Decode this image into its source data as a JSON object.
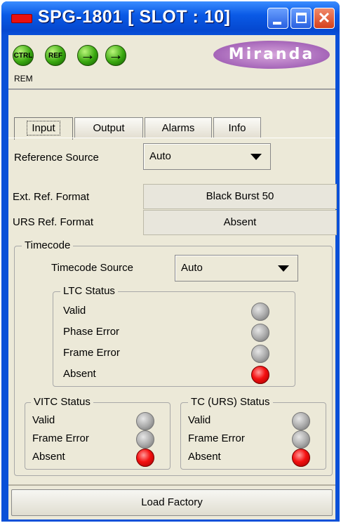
{
  "window": {
    "title": "SPG-1801 [ SLOT : 10]",
    "controls": {
      "minimize_icon": "minimize-icon",
      "maximize_icon": "maximize-icon",
      "close_icon": "close-icon",
      "close_glyph": "✕"
    }
  },
  "header": {
    "leds": [
      {
        "label": "CTRL",
        "color": "green"
      },
      {
        "label": "REF",
        "color": "green"
      },
      {
        "label": "→",
        "color": "green"
      },
      {
        "label": "→",
        "color": "green"
      }
    ],
    "mode_label": "REM",
    "brand": "Miranda"
  },
  "tabs": [
    {
      "label": "Input",
      "active": true
    },
    {
      "label": "Output",
      "active": false
    },
    {
      "label": "Alarms",
      "active": false
    },
    {
      "label": "Info",
      "active": false
    }
  ],
  "input": {
    "reference_source_label": "Reference Source",
    "reference_source_value": "Auto",
    "ext_ref_format_label": "Ext. Ref. Format",
    "ext_ref_format_value": "Black Burst 50",
    "urs_ref_format_label": "URS Ref. Format",
    "urs_ref_format_value": "Absent"
  },
  "timecode": {
    "title": "Timecode",
    "source_label": "Timecode Source",
    "source_value": "Auto",
    "ltc": {
      "title": "LTC Status",
      "rows": [
        {
          "label": "Valid",
          "state": "gray"
        },
        {
          "label": "Phase Error",
          "state": "gray"
        },
        {
          "label": "Frame Error",
          "state": "gray"
        },
        {
          "label": "Absent",
          "state": "red"
        }
      ]
    },
    "vitc": {
      "title": "VITC Status",
      "rows": [
        {
          "label": "Valid",
          "state": "gray"
        },
        {
          "label": "Frame Error",
          "state": "gray"
        },
        {
          "label": "Absent",
          "state": "red"
        }
      ]
    },
    "tc_urs": {
      "title": "TC (URS) Status",
      "rows": [
        {
          "label": "Valid",
          "state": "gray"
        },
        {
          "label": "Frame Error",
          "state": "gray"
        },
        {
          "label": "Absent",
          "state": "red"
        }
      ]
    }
  },
  "footer": {
    "load_factory_label": "Load Factory"
  },
  "colors": {
    "active_led": "#3aa810",
    "alarm_red": "#f41010",
    "idle_gray": "#a8a8a8",
    "titlebar": "#0a50d8"
  }
}
